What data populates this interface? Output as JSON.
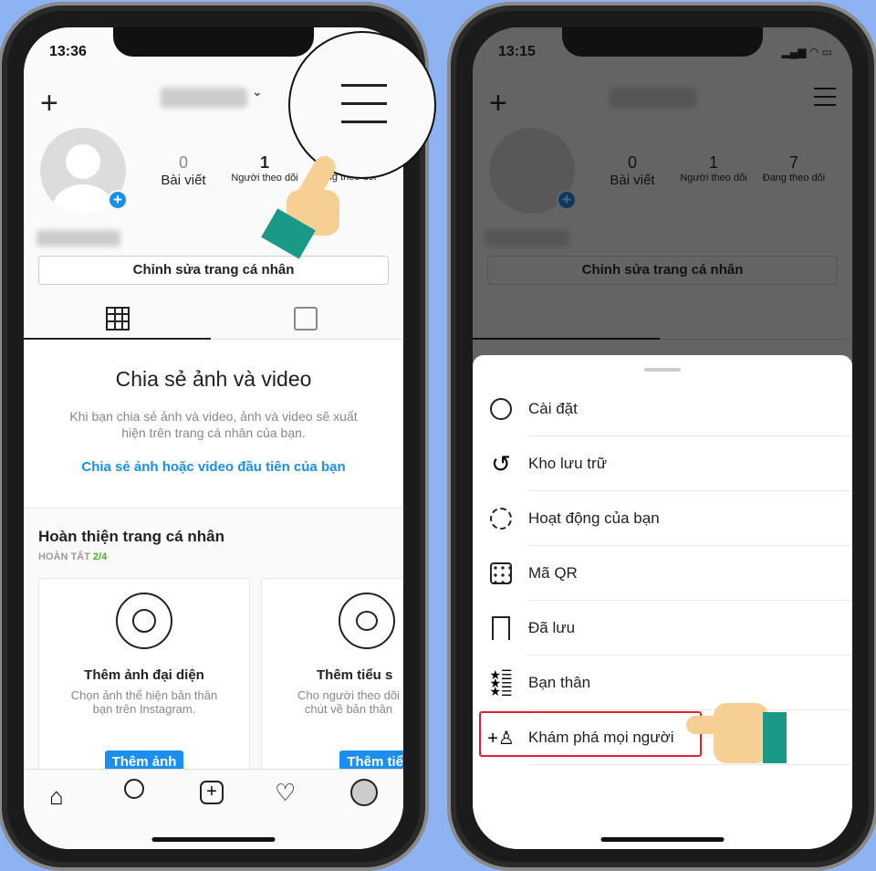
{
  "colors": {
    "background": "#8db3f2",
    "accent": "#1a8ff0",
    "progress": "#4caf1a",
    "highlight": "#e0232b"
  },
  "left": {
    "status_time": "13:36",
    "icons": {
      "add": "plus-icon",
      "menu": "hamburger-menu-icon"
    },
    "stats": [
      {
        "value": "0",
        "label": "Bài viết"
      },
      {
        "value": "1",
        "label": "Người theo dõi"
      },
      {
        "value": "",
        "label": "Đang theo dõi"
      }
    ],
    "edit_profile": "Chỉnh sửa trang cá nhân",
    "share": {
      "title": "Chia sẻ ảnh và video",
      "body": "Khi bạn chia sẻ ảnh và video, ảnh và video sẽ xuất hiện trên trang cá nhân của bạn.",
      "link": "Chia sẻ ảnh hoặc video đầu tiên của bạn"
    },
    "complete": {
      "title": "Hoàn thiện trang cá nhân",
      "status_label": "HOÀN TẤT",
      "progress": "2/4"
    },
    "cards": [
      {
        "title": "Thêm ảnh đại diện",
        "body": "Chọn ảnh thể hiện bản thân bạn trên Instagram.",
        "button": "Thêm ảnh"
      },
      {
        "title": "Thêm tiểu s",
        "body": "Cho người theo dõi chút về bản thân",
        "button": "Thêm tiểu s"
      }
    ]
  },
  "right": {
    "status_time": "13:15",
    "stats": [
      {
        "value": "0",
        "label": "Bài viết"
      },
      {
        "value": "1",
        "label": "Người theo dõi"
      },
      {
        "value": "7",
        "label": "Đang theo dõi"
      }
    ],
    "edit_profile": "Chỉnh sửa trang cá nhân",
    "menu": [
      {
        "label": "Cài đặt",
        "icon": "settings-gear-icon"
      },
      {
        "label": "Kho lưu trữ",
        "icon": "archive-history-icon"
      },
      {
        "label": "Hoạt động của bạn",
        "icon": "activity-clock-icon"
      },
      {
        "label": "Mã QR",
        "icon": "qr-code-icon"
      },
      {
        "label": "Đã lưu",
        "icon": "bookmark-icon"
      },
      {
        "label": "Bạn thân",
        "icon": "close-friends-list-icon"
      },
      {
        "label": "Khám phá mọi người",
        "icon": "discover-people-icon"
      }
    ]
  }
}
